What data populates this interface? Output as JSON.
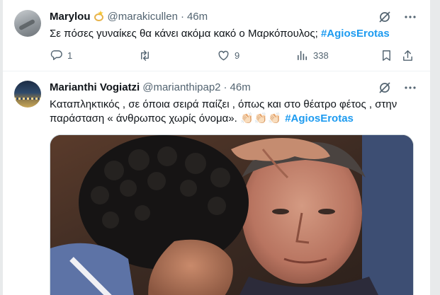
{
  "tweets": [
    {
      "name": "Marylou",
      "handle": "@marakicullen",
      "time": "46m",
      "text": "Σε πόσες γυναίκες θα κάνει ακόμα κακό ο Μαρκόπουλος;",
      "hashtag": "#AgiosErotas",
      "stats": {
        "replies": "1",
        "retweets": "",
        "likes": "9",
        "views": "338"
      }
    },
    {
      "name": "Marianthi Vogiatzi",
      "handle": "@marianthipap2",
      "time": "46m",
      "text_line1": "Καταπληκτικός , σε όποια σειρά παίζει , όπως και στο θέατρο φέτος , στην",
      "text_line2": "παράσταση « άνθρωπος χωρίς όνομα».",
      "emoji": "👏🏻👏🏻👏🏻",
      "hashtag": "#AgiosErotas"
    }
  ],
  "separator": "·",
  "icons": {
    "grok": "grok-slash-icon",
    "more": "more-dots-icon",
    "reply": "reply-icon",
    "retweet": "retweet-icon",
    "like": "heart-icon",
    "views": "views-bar-icon",
    "bookmark": "bookmark-icon",
    "share": "share-icon"
  },
  "colors": {
    "hashtag": "#1d9bf0",
    "muted": "#536471",
    "text": "#0f1419",
    "badge": "#e7b34b"
  }
}
